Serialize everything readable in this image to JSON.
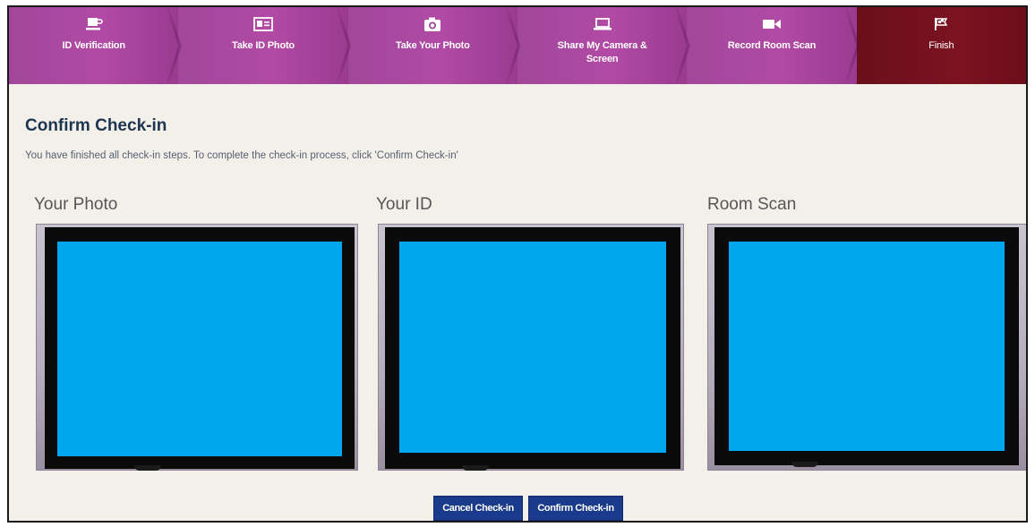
{
  "steps": [
    {
      "label": "ID Verification",
      "icon": "coffee-cup-icon"
    },
    {
      "label": "Take ID Photo",
      "icon": "id-card-icon"
    },
    {
      "label": "Take Your Photo",
      "icon": "camera-icon"
    },
    {
      "label": "Share My Camera & Screen",
      "icon": "laptop-icon"
    },
    {
      "label": "Record Room Scan",
      "icon": "video-camera-icon"
    },
    {
      "label": "Finish",
      "icon": "flag-icon"
    }
  ],
  "colors": {
    "step_bar": "#a1479a",
    "step_final": "#6a0f1c",
    "placeholder_blue": "#00a6ee",
    "button": "#1a3b8c"
  },
  "page": {
    "title": "Confirm Check-in",
    "instructions": "You have finished all check-in steps. To complete the check-in process, click 'Confirm Check-in'"
  },
  "panels": {
    "photo_label": "Your Photo",
    "id_label": "Your ID",
    "room_label": "Room Scan"
  },
  "buttons": {
    "cancel": "Cancel Check-in",
    "confirm": "Confirm Check-in"
  }
}
